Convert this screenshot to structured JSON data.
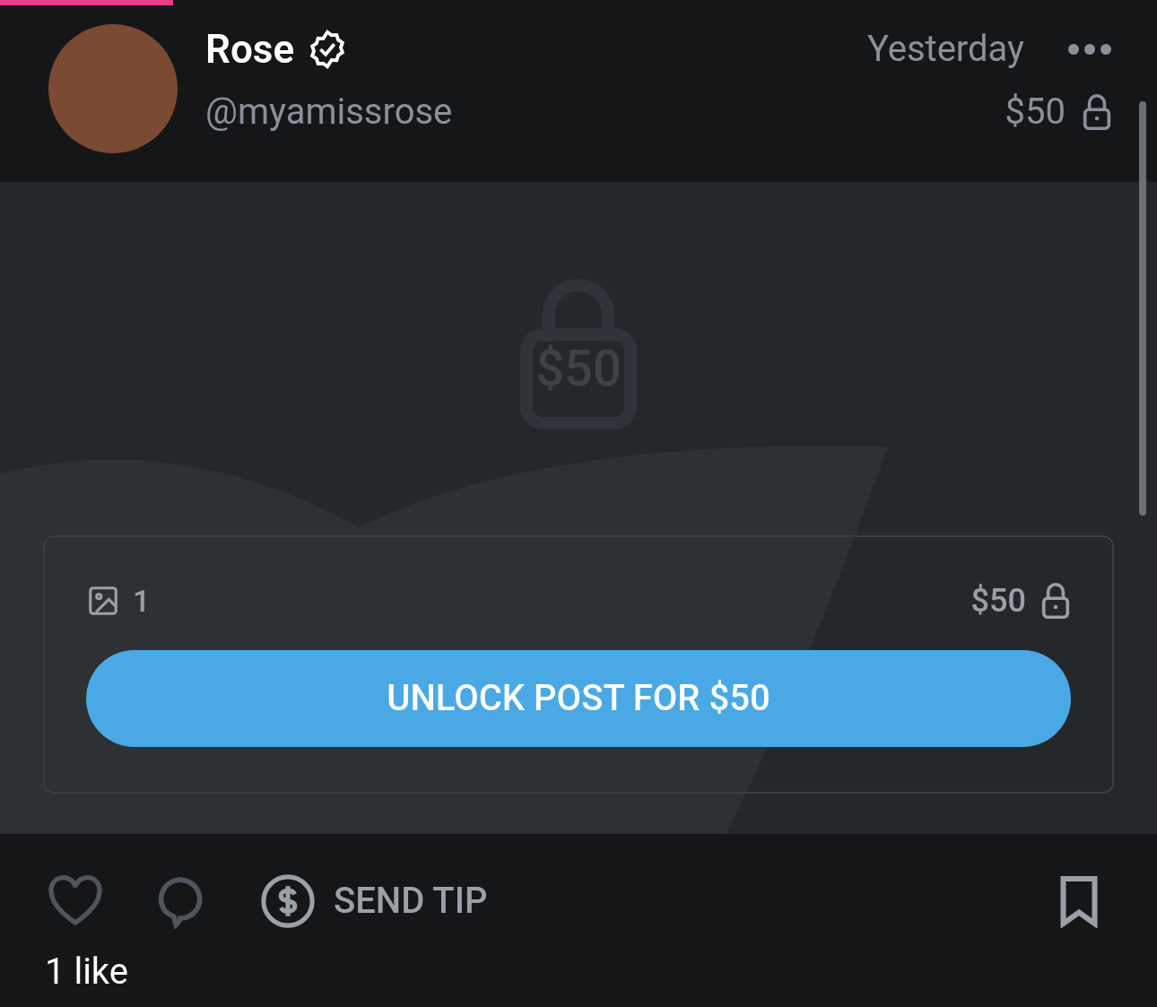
{
  "post": {
    "author": {
      "name": "Rose",
      "verified": true,
      "handle": "@myamissrose"
    },
    "time": "Yesterday",
    "price": "$50"
  },
  "media": {
    "lock_price": "$50",
    "count": "1",
    "price": "$50",
    "unlock_button": "UNLOCK POST FOR $50"
  },
  "actions": {
    "send_tip": "SEND TIP"
  },
  "likes": "1 like"
}
